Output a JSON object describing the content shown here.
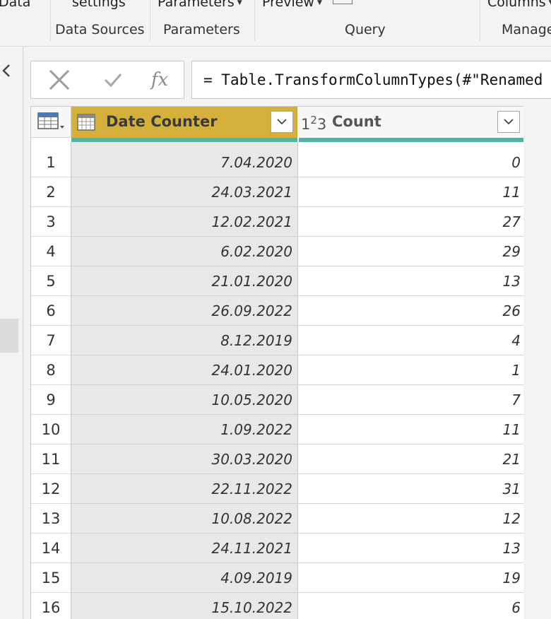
{
  "ribbon": {
    "items": [
      {
        "top": "Data",
        "group": ""
      },
      {
        "top": "settings",
        "group": "Data Sources"
      },
      {
        "top": "Parameters",
        "group": "Parameters"
      },
      {
        "top": "Preview",
        "group": "Query"
      },
      {
        "top": "Columns",
        "group": "Manage"
      }
    ]
  },
  "formula": {
    "cancel_icon": "x-icon",
    "commit_icon": "check-icon",
    "fx_label": "fx",
    "text": "= Table.TransformColumnTypes(#\"Renamed"
  },
  "table": {
    "columns": [
      {
        "name": "Date Counter",
        "type_icon": "date-type-icon",
        "selected": true
      },
      {
        "name": "Count",
        "type_label": "123",
        "type_icon": "whole-number-icon",
        "selected": false
      }
    ],
    "rows": [
      {
        "n": "1",
        "date": "7.04.2020",
        "count": "0"
      },
      {
        "n": "2",
        "date": "24.03.2021",
        "count": "11"
      },
      {
        "n": "3",
        "date": "12.02.2021",
        "count": "27"
      },
      {
        "n": "4",
        "date": "6.02.2020",
        "count": "29"
      },
      {
        "n": "5",
        "date": "21.01.2020",
        "count": "13"
      },
      {
        "n": "6",
        "date": "26.09.2022",
        "count": "26"
      },
      {
        "n": "7",
        "date": "8.12.2019",
        "count": "4"
      },
      {
        "n": "8",
        "date": "24.01.2020",
        "count": "1"
      },
      {
        "n": "9",
        "date": "10.05.2020",
        "count": "7"
      },
      {
        "n": "10",
        "date": "1.09.2022",
        "count": "11"
      },
      {
        "n": "11",
        "date": "30.03.2020",
        "count": "21"
      },
      {
        "n": "12",
        "date": "22.11.2022",
        "count": "31"
      },
      {
        "n": "13",
        "date": "10.08.2022",
        "count": "12"
      },
      {
        "n": "14",
        "date": "24.11.2021",
        "count": "13"
      },
      {
        "n": "15",
        "date": "4.09.2019",
        "count": "19"
      },
      {
        "n": "16",
        "date": "15.10.2022",
        "count": "6"
      }
    ]
  },
  "colors": {
    "selected_header": "#d5b13c",
    "quality_bar": "#4fb3a6",
    "selected_column_bg": "#e8e8e8"
  }
}
